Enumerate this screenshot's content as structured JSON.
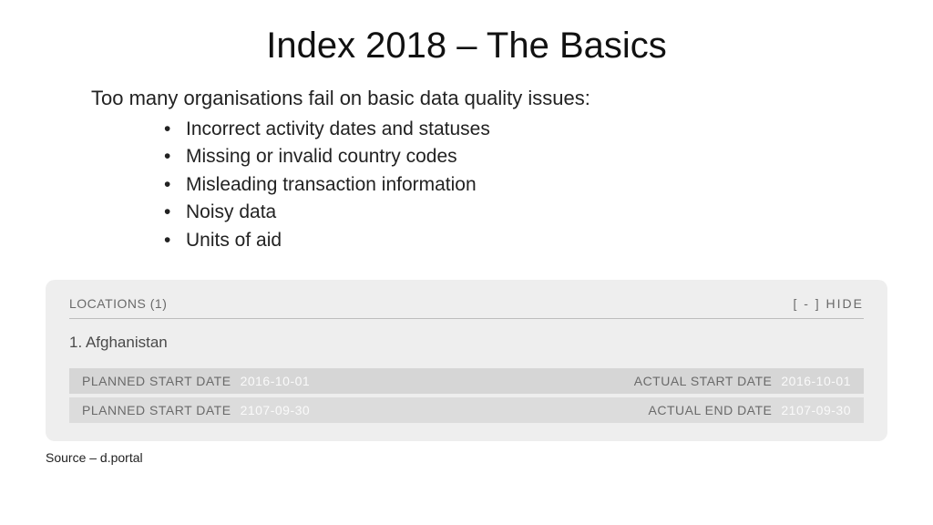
{
  "title": "Index 2018 – The Basics",
  "intro": "Too many organisations fail on basic data quality issues:",
  "bullets": [
    "Incorrect activity dates and statuses",
    "Missing or invalid country codes",
    "Misleading transaction information",
    "Noisy data",
    "Units of aid"
  ],
  "panel": {
    "header_left": "LOCATIONS (1)",
    "header_right": "[ - ]  HIDE",
    "location_item": "1. Afghanistan",
    "rows": [
      {
        "left_label": "PLANNED START DATE",
        "left_value": "2016-10-01",
        "right_label": "ACTUAL START DATE",
        "right_value": "2016-10-01"
      },
      {
        "left_label": "PLANNED START DATE",
        "left_value": "2107-09-30",
        "right_label": "ACTUAL END DATE",
        "right_value": "2107-09-30"
      }
    ]
  },
  "source": "Source – d.portal"
}
